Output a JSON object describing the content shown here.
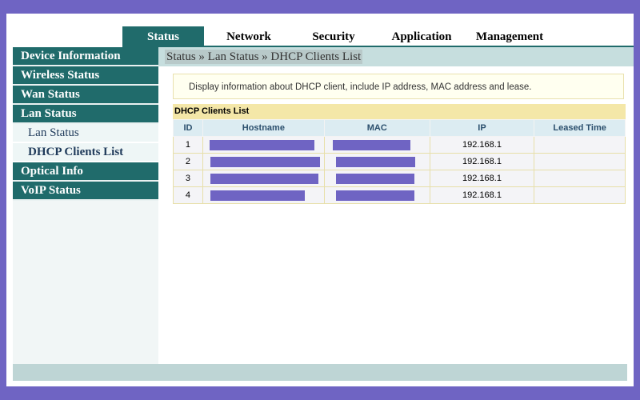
{
  "topnav": {
    "tabs": [
      {
        "label": "Status"
      },
      {
        "label": "Network"
      },
      {
        "label": "Security"
      },
      {
        "label": "Application"
      },
      {
        "label": "Management"
      }
    ]
  },
  "sidebar": {
    "items": [
      {
        "label": "Device Information"
      },
      {
        "label": "Wireless Status"
      },
      {
        "label": "Wan Status"
      },
      {
        "label": "Lan Status"
      },
      {
        "label": "Optical Info"
      },
      {
        "label": "VoIP Status"
      }
    ],
    "subitems": [
      {
        "label": "Lan Status"
      },
      {
        "label": "DHCP Clients List"
      }
    ]
  },
  "breadcrumb": "Status » Lan Status » DHCP Clients List",
  "info": "Display information about DHCP client, include IP address, MAC address and lease.",
  "table": {
    "title": "DHCP Clients List",
    "headers": [
      "ID",
      "Hostname",
      "MAC",
      "IP",
      "Leased Time"
    ],
    "rows": [
      {
        "id": "1",
        "ip": "192.168.1",
        "leased": ""
      },
      {
        "id": "2",
        "ip": "192.168.1",
        "leased": ""
      },
      {
        "id": "3",
        "ip": "192.168.1",
        "leased": ""
      },
      {
        "id": "4",
        "ip": "192.168.1",
        "leased": ""
      }
    ]
  },
  "colors": {
    "accent": "#206b6b",
    "redaction": "#6f64c3",
    "border": "#6f64c3"
  }
}
